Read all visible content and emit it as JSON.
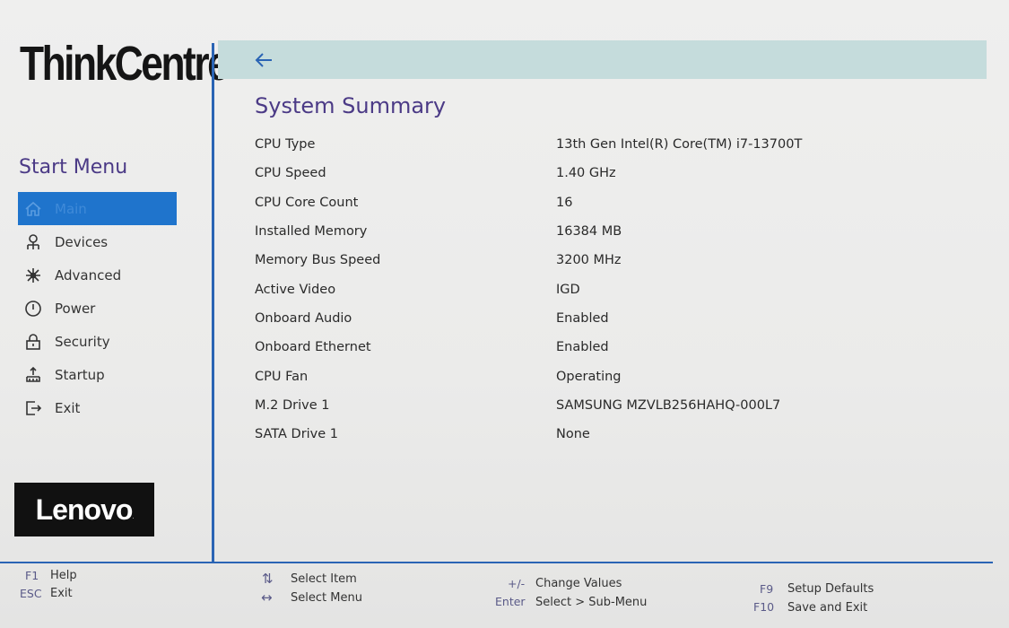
{
  "brand": {
    "product_logo": "ThinkCentre",
    "vendor_logo": "Lenovo"
  },
  "sidebar": {
    "title": "Start Menu",
    "items": [
      {
        "label": "Main",
        "icon": "home-icon",
        "active": true
      },
      {
        "label": "Devices",
        "icon": "devices-icon"
      },
      {
        "label": "Advanced",
        "icon": "advanced-icon"
      },
      {
        "label": "Power",
        "icon": "power-icon"
      },
      {
        "label": "Security",
        "icon": "lock-icon"
      },
      {
        "label": "Startup",
        "icon": "startup-icon"
      },
      {
        "label": "Exit",
        "icon": "exit-icon"
      }
    ]
  },
  "header": {
    "back_icon": "back-arrow-icon"
  },
  "main": {
    "title": "System Summary",
    "rows": [
      {
        "label": "CPU Type",
        "value": "13th Gen Intel(R) Core(TM) i7-13700T"
      },
      {
        "label": "CPU Speed",
        "value": "1.40 GHz"
      },
      {
        "label": "CPU Core Count",
        "value": "16"
      },
      {
        "label": "Installed Memory",
        "value": "16384 MB"
      },
      {
        "label": "Memory Bus Speed",
        "value": "3200 MHz"
      },
      {
        "label": "Active Video",
        "value": "IGD"
      },
      {
        "label": "Onboard Audio",
        "value": "Enabled"
      },
      {
        "label": "Onboard Ethernet",
        "value": "Enabled"
      },
      {
        "label": "CPU Fan",
        "value": "Operating"
      },
      {
        "label": "M.2 Drive 1",
        "value": "SAMSUNG MZVLB256HAHQ-000L7"
      },
      {
        "label": "SATA Drive 1",
        "value": "None"
      }
    ]
  },
  "footer": {
    "f1_key": "F1",
    "f1_label": "Help",
    "esc_key": "ESC",
    "esc_label": "Exit",
    "updown_key": "⇅",
    "updown_label": "Select Item",
    "leftright_key": "↔",
    "leftright_label": "Select Menu",
    "plusminus_key": "+/-",
    "plusminus_label": "Change Values",
    "enter_key": "Enter",
    "enter_label": "Select > Sub-Menu",
    "f9_key": "F9",
    "f9_label": "Setup Defaults",
    "f10_key": "F10",
    "f10_label": "Save and Exit"
  },
  "colors": {
    "accent_purple": "#4b3a86",
    "active_blue": "#1f74cc",
    "divider_blue": "#2a64b4",
    "header_bar": "#c5dcdc"
  }
}
